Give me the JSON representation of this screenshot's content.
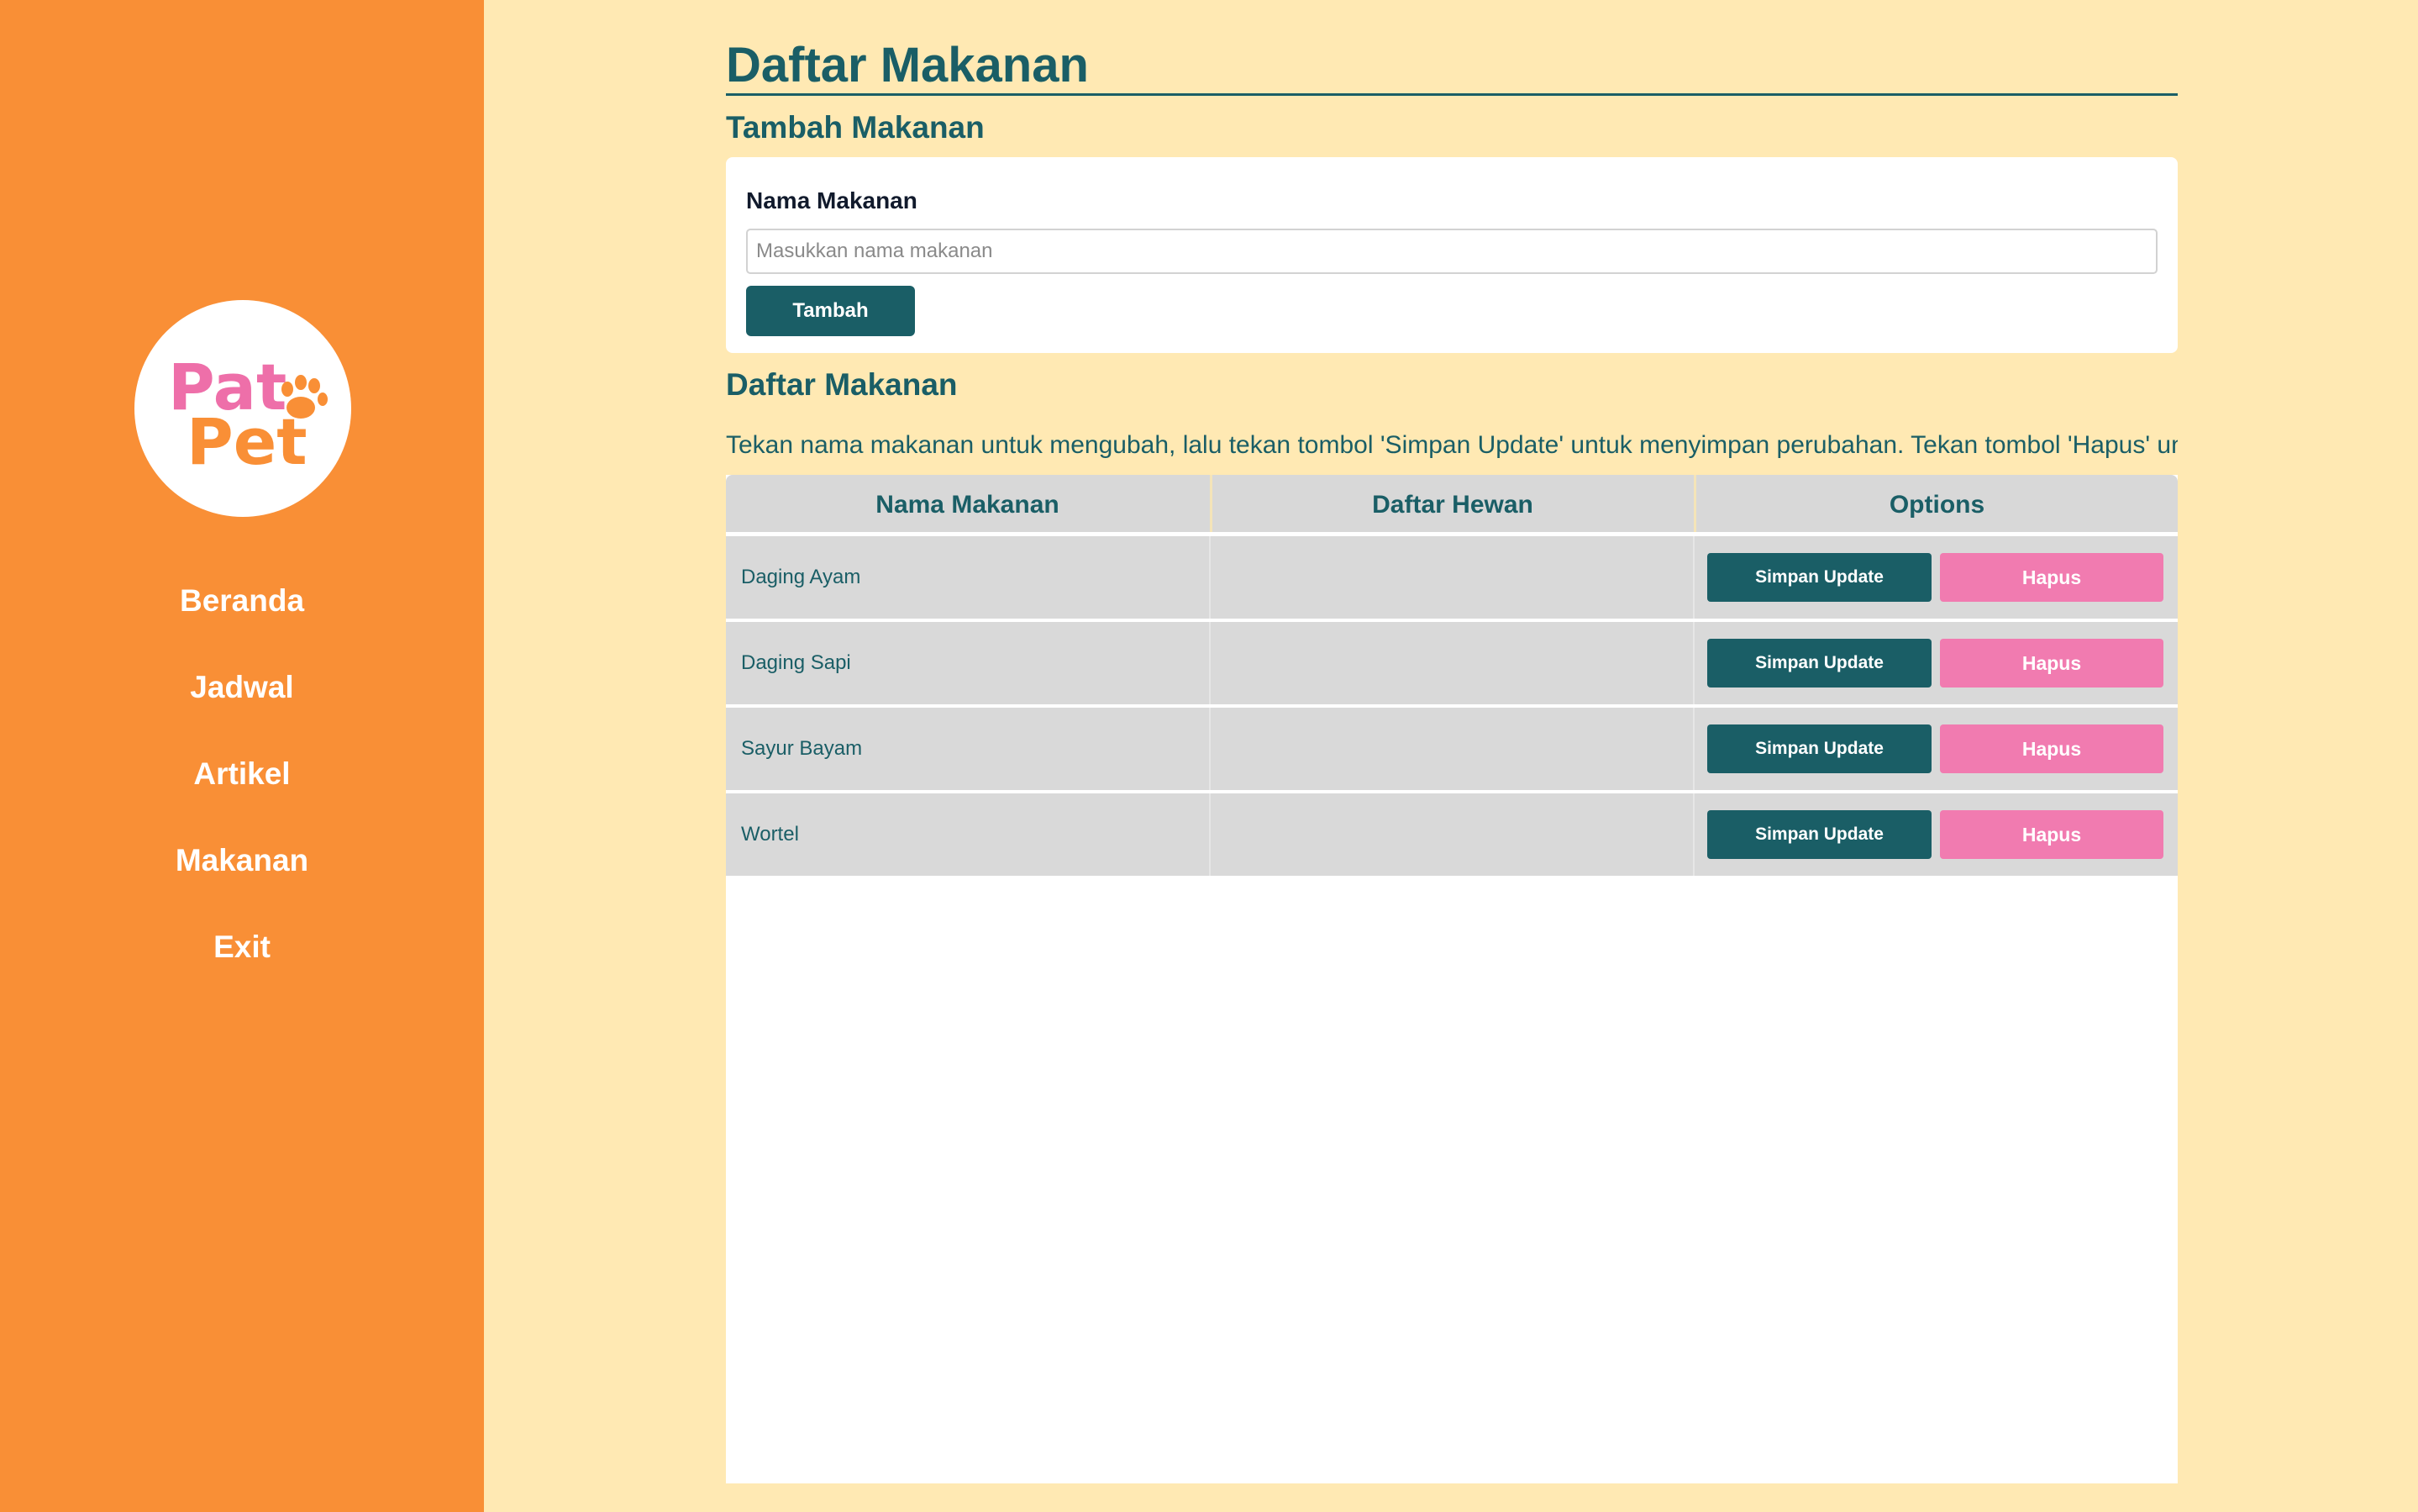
{
  "sidebar": {
    "logo": {
      "line1": "Pat",
      "line2": "Pet",
      "icon": "paw-icon"
    },
    "nav": [
      {
        "label": "Beranda"
      },
      {
        "label": "Jadwal"
      },
      {
        "label": "Artikel"
      },
      {
        "label": "Makanan"
      },
      {
        "label": "Exit"
      }
    ]
  },
  "main": {
    "title": "Daftar Makanan",
    "add_section": {
      "title": "Tambah Makanan",
      "field_label": "Nama Makanan",
      "placeholder": "Masukkan nama makanan",
      "value": "",
      "button_label": "Tambah"
    },
    "list_section": {
      "title": "Daftar Makanan",
      "instructions": "Tekan nama makanan untuk mengubah,  lalu tekan tombol 'Simpan Update' untuk menyimpan perubahan. Tekan tombol 'Hapus' untuk",
      "columns": [
        "Nama Makanan",
        "Daftar Hewan",
        "Options"
      ],
      "rows": [
        {
          "name": "Daging Ayam",
          "hewan": "",
          "update_label": "Simpan Update",
          "delete_label": "Hapus"
        },
        {
          "name": "Daging Sapi",
          "hewan": "",
          "update_label": "Simpan Update",
          "delete_label": "Hapus"
        },
        {
          "name": "Sayur Bayam",
          "hewan": "",
          "update_label": "Simpan Update",
          "delete_label": "Hapus"
        },
        {
          "name": "Wortel",
          "hewan": "",
          "update_label": "Simpan Update",
          "delete_label": "Hapus"
        }
      ]
    }
  },
  "colors": {
    "sidebar": "#f98f36",
    "background": "#ffe9b3",
    "primary": "#1a5e66",
    "danger": "#f17bb0",
    "logo_pink": "#ee6fa9",
    "logo_orange": "#f98f36"
  }
}
